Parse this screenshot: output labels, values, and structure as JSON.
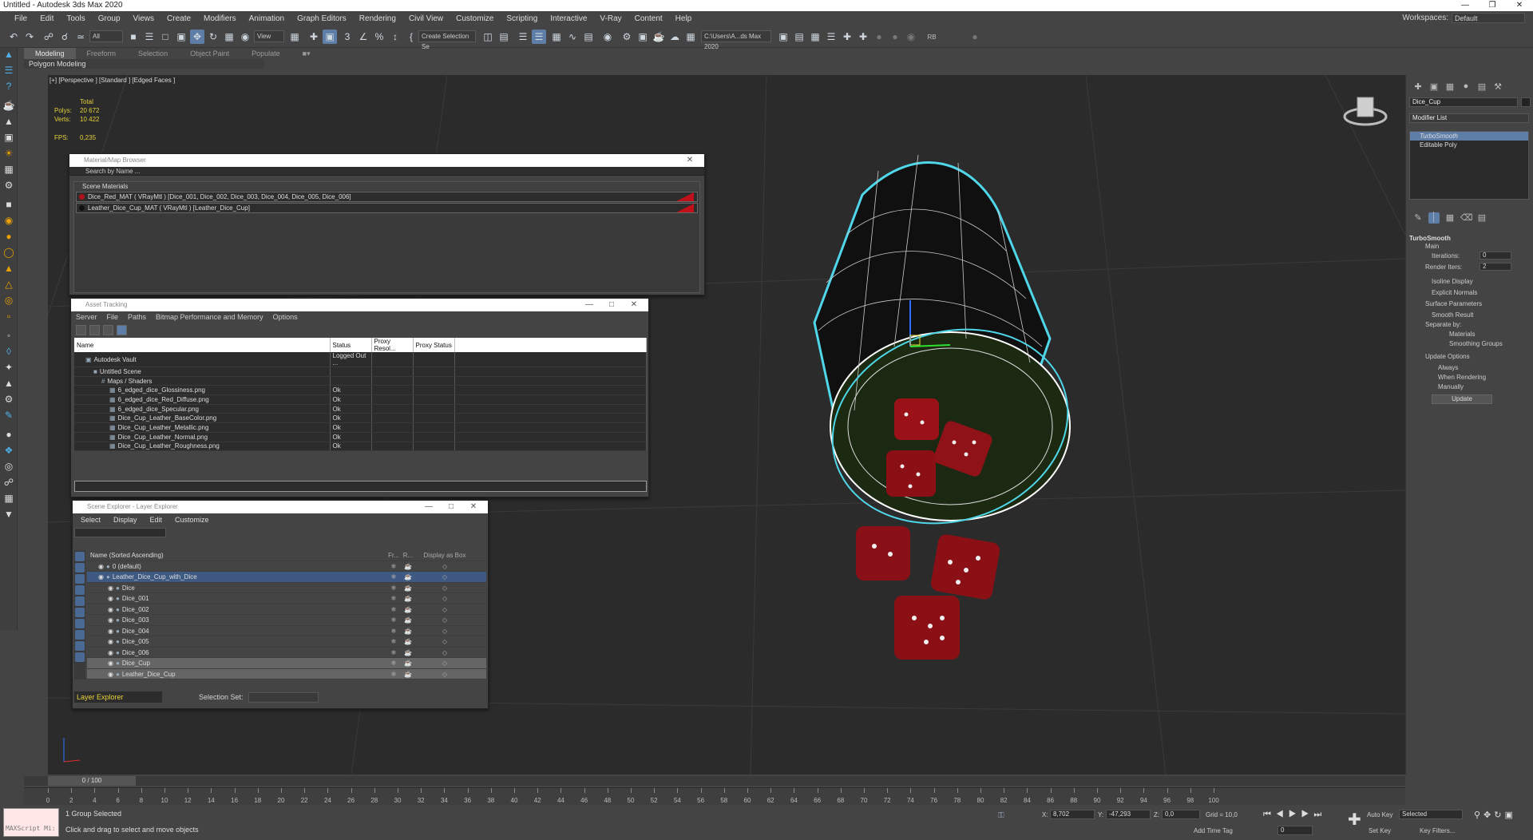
{
  "window": {
    "title": "Untitled - Autodesk 3ds Max 2020"
  },
  "menu": [
    "File",
    "Edit",
    "Tools",
    "Group",
    "Views",
    "Create",
    "Modifiers",
    "Animation",
    "Graph Editors",
    "Rendering",
    "Civil View",
    "Customize",
    "Scripting",
    "Interactive",
    "V-Ray",
    "Content",
    "Help"
  ],
  "workspaces": {
    "label": "Workspaces:",
    "value": "Default"
  },
  "toolbar": {
    "filter_all": "All",
    "ref_coord": "View",
    "selection_set": "Create Selection Se",
    "project_path": "C:\\Users\\A...ds Max 2020",
    "rb_label": "RB"
  },
  "ribbon": {
    "tabs": [
      "Modeling",
      "Freeform",
      "Selection",
      "Object Paint",
      "Populate"
    ],
    "subtab": "Polygon Modeling"
  },
  "viewport": {
    "label": "[+] [Perspective ] [Standard ] [Edged Faces ]",
    "stats": {
      "total_label": "Total",
      "polys_label": "Polys:",
      "polys": "20 672",
      "verts_label": "Verts:",
      "verts": "10 422",
      "fps_label": "FPS:",
      "fps": "0,235"
    }
  },
  "material_browser": {
    "title": "Material/Map Browser",
    "search_placeholder": "Search by Name ...",
    "section": "Scene Materials",
    "materials": [
      {
        "label": "Dice_Red_MAT  ( VRayMtl )  [Dice_001, Dice_002, Dice_003, Dice_004, Dice_005, Dice_006]",
        "swatch": "#b0101a"
      },
      {
        "label": "Leather_Dice_Cup_MAT  ( VRayMtl )  [Leather_Dice_Cup]",
        "swatch": "#111111"
      }
    ]
  },
  "asset_tracking": {
    "title": "Asset Tracking",
    "menu": [
      "Server",
      "File",
      "Paths",
      "Bitmap Performance and Memory",
      "Options"
    ],
    "columns": [
      "Name",
      "Status",
      "Proxy Resol...",
      "Proxy Status"
    ],
    "rows": [
      {
        "name": "Autodesk Vault",
        "status": "Logged Out ...",
        "indent": 0
      },
      {
        "name": "Untitled Scene",
        "status": "",
        "indent": 1
      },
      {
        "name": "Maps / Shaders",
        "status": "",
        "indent": 2
      },
      {
        "name": "6_edged_dice_Glossiness.png",
        "status": "Ok",
        "indent": 3
      },
      {
        "name": "6_edged_dice_Red_Diffuse.png",
        "status": "Ok",
        "indent": 3
      },
      {
        "name": "6_edged_dice_Specular.png",
        "status": "Ok",
        "indent": 3
      },
      {
        "name": "Dice_Cup_Leather_BaseColor.png",
        "status": "Ok",
        "indent": 3
      },
      {
        "name": "Dice_Cup_Leather_Metallic.png",
        "status": "Ok",
        "indent": 3
      },
      {
        "name": "Dice_Cup_Leather_Normal.png",
        "status": "Ok",
        "indent": 3
      },
      {
        "name": "Dice_Cup_Leather_Roughness.png",
        "status": "Ok",
        "indent": 3
      }
    ]
  },
  "scene_explorer": {
    "title": "Scene Explorer - Layer Explorer",
    "menu": [
      "Select",
      "Display",
      "Edit",
      "Customize"
    ],
    "columns": [
      "Name (Sorted Ascending)",
      "Fr...",
      "R...",
      "Display as Box"
    ],
    "rows": [
      {
        "name": "0 (default)",
        "indent": 0,
        "state": ""
      },
      {
        "name": "Leather_Dice_Cup_with_Dice",
        "indent": 0,
        "state": "sel"
      },
      {
        "name": "Dice",
        "indent": 1,
        "state": ""
      },
      {
        "name": "Dice_001",
        "indent": 1,
        "state": ""
      },
      {
        "name": "Dice_002",
        "indent": 1,
        "state": ""
      },
      {
        "name": "Dice_003",
        "indent": 1,
        "state": ""
      },
      {
        "name": "Dice_004",
        "indent": 1,
        "state": ""
      },
      {
        "name": "Dice_005",
        "indent": 1,
        "state": ""
      },
      {
        "name": "Dice_006",
        "indent": 1,
        "state": ""
      },
      {
        "name": "Dice_Cup",
        "indent": 1,
        "state": "gr"
      },
      {
        "name": "Leather_Dice_Cup",
        "indent": 1,
        "state": "gr"
      }
    ],
    "footer": {
      "explorer": "Layer Explorer",
      "selection_set_label": "Selection Set:"
    }
  },
  "command_panel": {
    "object_name": "Dice_Cup",
    "modifier_list_label": "Modifier List",
    "stack": [
      "TurboSmooth",
      "Editable Poly"
    ],
    "rollout": "TurboSmooth",
    "main_label": "Main",
    "iterations_label": "Iterations:",
    "iterations": "0",
    "render_iters_label": "Render Iters:",
    "render_iters": "2",
    "isoline": "Isoline Display",
    "explicit_normals": "Explicit Normals",
    "surface_params": "Surface Parameters",
    "smooth_result": "Smooth Result",
    "separate_by": "Separate by:",
    "materials": "Materials",
    "smoothing_groups": "Smoothing Groups",
    "update_options": "Update Options",
    "always": "Always",
    "when_rendering": "When Rendering",
    "manually": "Manually",
    "update_button": "Update"
  },
  "timeline": {
    "frame": "0 / 100",
    "ticks": [
      0,
      2,
      4,
      6,
      8,
      10,
      12,
      14,
      16,
      18,
      20,
      22,
      24,
      26,
      28,
      30,
      32,
      34,
      36,
      38,
      40,
      42,
      44,
      46,
      48,
      50,
      52,
      54,
      56,
      58,
      60,
      62,
      64,
      66,
      68,
      70,
      72,
      74,
      76,
      78,
      80,
      82,
      84,
      86,
      88,
      90,
      92,
      94,
      96,
      98,
      100
    ]
  },
  "status": {
    "maxscript": "MAXScript Mi:",
    "selection": "1 Group Selected",
    "prompt": "Click and drag to select and move objects",
    "x_label": "X:",
    "x": "8,702",
    "y_label": "Y:",
    "y": "-47,293",
    "z_label": "Z:",
    "z": "0,0",
    "grid": "Grid = 10,0",
    "add_time_tag": "Add Time Tag",
    "frame": "0",
    "auto_key": "Auto Key",
    "set_key": "Set Key",
    "selected": "Selected",
    "key_filters": "Key Filters..."
  }
}
